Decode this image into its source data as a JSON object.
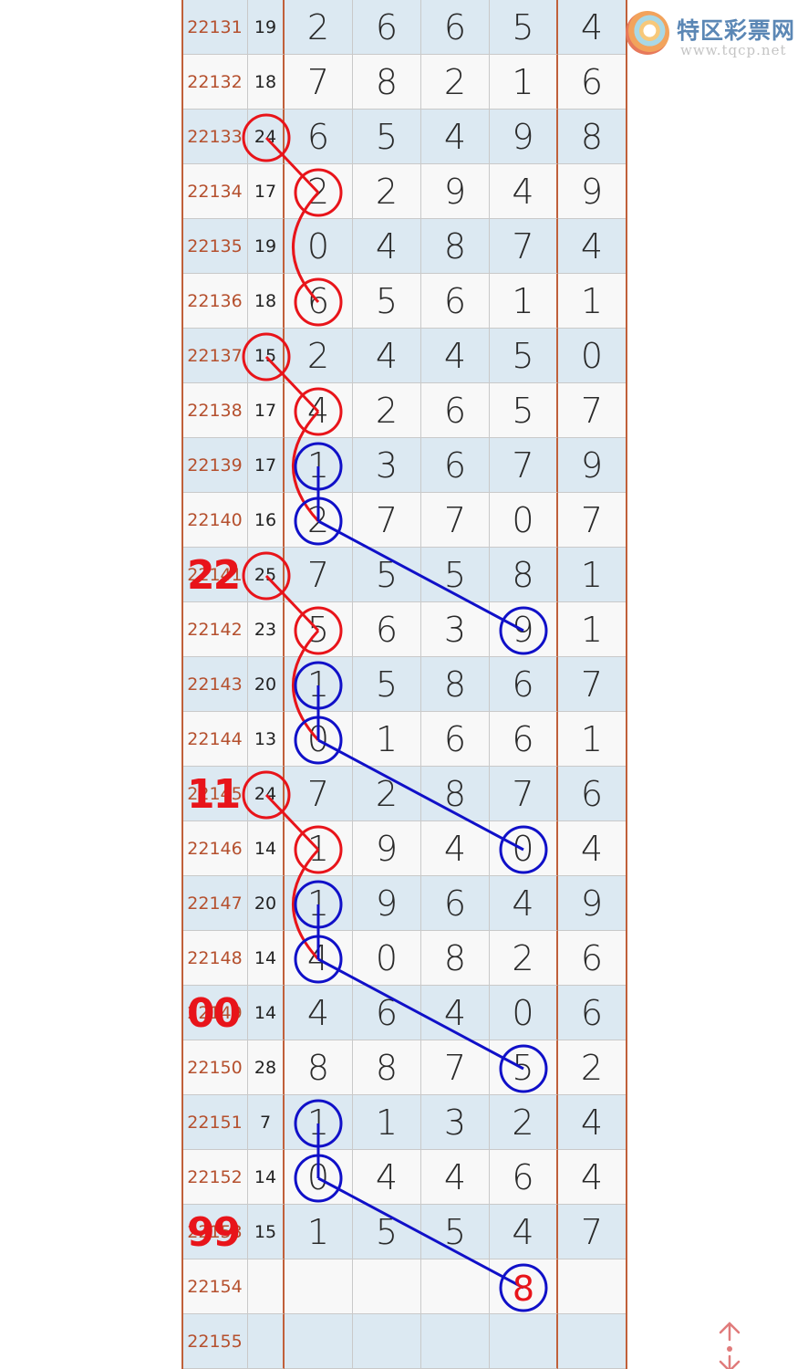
{
  "logo": {
    "name": "特区彩票网",
    "url": "www.tqcp.net"
  },
  "columns": [
    "issue",
    "sum",
    "d1",
    "d2",
    "d3",
    "d4",
    "d5"
  ],
  "rows": [
    {
      "issue": "22131",
      "sum": "19",
      "digits": [
        "2",
        "6",
        "6",
        "5",
        "4"
      ]
    },
    {
      "issue": "22132",
      "sum": "18",
      "digits": [
        "7",
        "8",
        "2",
        "1",
        "6"
      ]
    },
    {
      "issue": "22133",
      "sum": "24",
      "digits": [
        "6",
        "5",
        "4",
        "9",
        "8"
      ]
    },
    {
      "issue": "22134",
      "sum": "17",
      "digits": [
        "2",
        "2",
        "9",
        "4",
        "9"
      ]
    },
    {
      "issue": "22135",
      "sum": "19",
      "digits": [
        "0",
        "4",
        "8",
        "7",
        "4"
      ]
    },
    {
      "issue": "22136",
      "sum": "18",
      "digits": [
        "6",
        "5",
        "6",
        "1",
        "1"
      ]
    },
    {
      "issue": "22137",
      "sum": "15",
      "digits": [
        "2",
        "4",
        "4",
        "5",
        "0"
      ]
    },
    {
      "issue": "22138",
      "sum": "17",
      "digits": [
        "4",
        "2",
        "6",
        "5",
        "7"
      ]
    },
    {
      "issue": "22139",
      "sum": "17",
      "digits": [
        "1",
        "3",
        "6",
        "7",
        "9"
      ]
    },
    {
      "issue": "22140",
      "sum": "16",
      "digits": [
        "2",
        "7",
        "7",
        "0",
        "7"
      ]
    },
    {
      "issue": "22141",
      "sum": "25",
      "digits": [
        "7",
        "5",
        "5",
        "8",
        "1"
      ]
    },
    {
      "issue": "22142",
      "sum": "23",
      "digits": [
        "5",
        "6",
        "3",
        "9",
        "1"
      ]
    },
    {
      "issue": "22143",
      "sum": "20",
      "digits": [
        "1",
        "5",
        "8",
        "6",
        "7"
      ]
    },
    {
      "issue": "22144",
      "sum": "13",
      "digits": [
        "0",
        "1",
        "6",
        "6",
        "1"
      ]
    },
    {
      "issue": "22145",
      "sum": "24",
      "digits": [
        "7",
        "2",
        "8",
        "7",
        "6"
      ]
    },
    {
      "issue": "22146",
      "sum": "14",
      "digits": [
        "1",
        "9",
        "4",
        "0",
        "4"
      ]
    },
    {
      "issue": "22147",
      "sum": "20",
      "digits": [
        "1",
        "9",
        "6",
        "4",
        "9"
      ]
    },
    {
      "issue": "22148",
      "sum": "14",
      "digits": [
        "4",
        "0",
        "8",
        "2",
        "6"
      ]
    },
    {
      "issue": "22149",
      "sum": "14",
      "digits": [
        "4",
        "6",
        "4",
        "0",
        "6"
      ]
    },
    {
      "issue": "22150",
      "sum": "28",
      "digits": [
        "8",
        "8",
        "7",
        "5",
        "2"
      ]
    },
    {
      "issue": "22151",
      "sum": "7",
      "digits": [
        "1",
        "1",
        "3",
        "2",
        "4"
      ]
    },
    {
      "issue": "22152",
      "sum": "14",
      "digits": [
        "0",
        "4",
        "4",
        "6",
        "4"
      ]
    },
    {
      "issue": "22153",
      "sum": "15",
      "digits": [
        "1",
        "5",
        "5",
        "4",
        "7"
      ]
    },
    {
      "issue": "22154",
      "sum": "",
      "digits": [
        "",
        "",
        "",
        "",
        ""
      ]
    },
    {
      "issue": "22155",
      "sum": "",
      "digits": [
        "",
        "",
        "",
        "",
        ""
      ]
    }
  ],
  "annotations": {
    "red_color": "#e8141a",
    "blue_color": "#1010c8",
    "red_groups": [
      {
        "sum_row": "22133",
        "digit_rows": [
          "22134",
          "22136"
        ]
      },
      {
        "sum_row": "22137",
        "digit_rows": [
          "22138",
          "22140"
        ]
      },
      {
        "sum_row": "22141",
        "digit_rows": [
          "22142",
          "22144"
        ]
      },
      {
        "sum_row": "22145",
        "digit_rows": [
          "22146",
          "22148"
        ]
      }
    ],
    "blue_groups": [
      {
        "d1_rows": [
          "22139",
          "22140"
        ],
        "d4_row": "22142"
      },
      {
        "d1_rows": [
          "22143",
          "22144"
        ],
        "d4_row": "22146"
      },
      {
        "d1_rows": [
          "22147",
          "22148"
        ],
        "d4_row": "22150"
      },
      {
        "d1_rows": [
          "22151",
          "22152"
        ],
        "d4_row": "22154"
      }
    ],
    "marks": [
      {
        "row": "22141",
        "text": "22"
      },
      {
        "row": "22145",
        "text": "11"
      },
      {
        "row": "22149",
        "text": "00"
      },
      {
        "row": "22153",
        "text": "99"
      }
    ],
    "prediction": {
      "row": "22154",
      "col": "d4",
      "value": "8"
    }
  },
  "scroll_control": {
    "icon": "scroll-up-down-icon",
    "color": "#e07b7b"
  }
}
